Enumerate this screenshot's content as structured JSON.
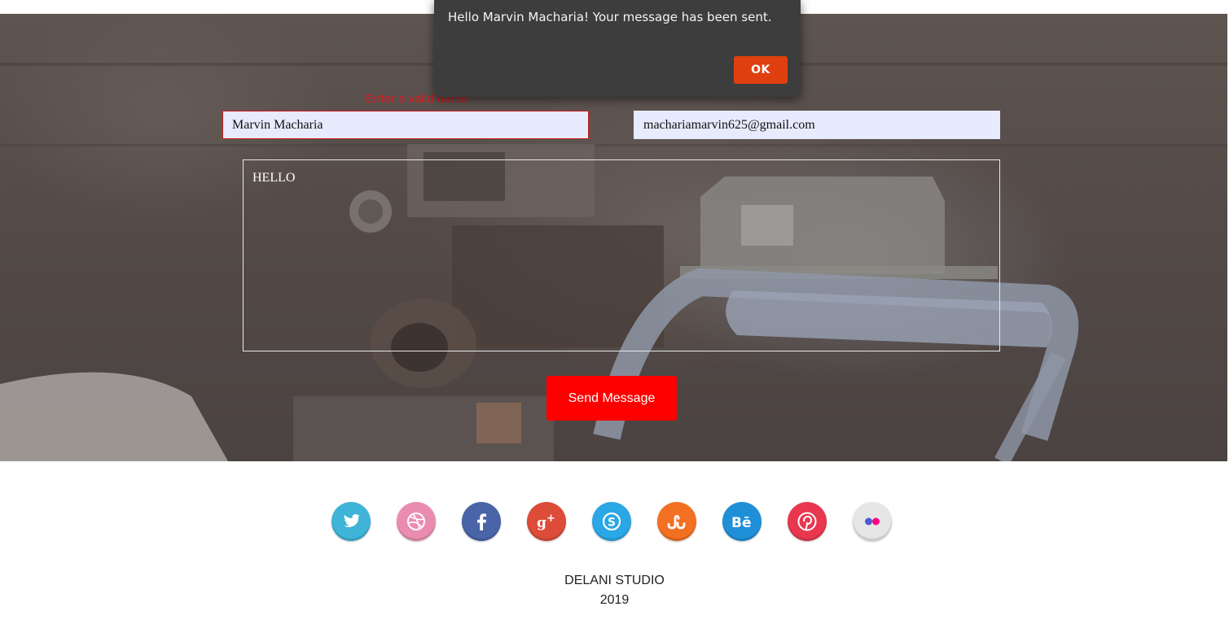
{
  "contact_form": {
    "name_value": "Marvin Macharia",
    "name_error": "Enter a valid name",
    "email_value": "machariamarvin625@gmail.com",
    "message_value": "HELLO",
    "send_label": "Send Message"
  },
  "alert_dialog": {
    "message": "Hello Marvin Macharia! Your message has been sent.",
    "ok_label": "OK"
  },
  "social_icons": [
    {
      "name": "twitter-icon",
      "color": "#3fb3d8"
    },
    {
      "name": "dribbble-icon",
      "color": "#ea8cb0"
    },
    {
      "name": "facebook-icon",
      "color": "#4a64a8"
    },
    {
      "name": "google-plus-icon",
      "color": "#dd4b39"
    },
    {
      "name": "skype-icon",
      "color": "#2aa7e5"
    },
    {
      "name": "stumbleupon-icon",
      "color": "#f36f22"
    },
    {
      "name": "behance-icon",
      "color": "#1f8fd8"
    },
    {
      "name": "pinterest-icon",
      "color": "#e8374e"
    },
    {
      "name": "flickr-icon",
      "color": "#e6e6e6"
    }
  ],
  "footer": {
    "studio": "DELANI STUDIO",
    "year": "2019"
  }
}
